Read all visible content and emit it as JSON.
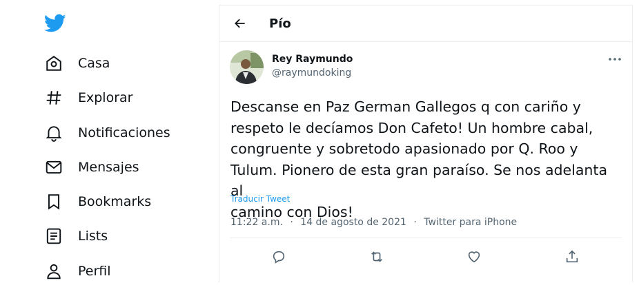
{
  "colors": {
    "brand": "#1d9bf0",
    "text": "#0f1419",
    "muted": "#536471",
    "border": "#ebeef0"
  },
  "sidebar": {
    "logo_icon": "twitter-bird-icon",
    "items": [
      {
        "label": "Casa",
        "icon": "home-icon"
      },
      {
        "label": "Explorar",
        "icon": "hashtag-icon"
      },
      {
        "label": "Notificaciones",
        "icon": "bell-icon"
      },
      {
        "label": "Mensajes",
        "icon": "mail-icon"
      },
      {
        "label": "Bookmarks",
        "icon": "bookmark-icon"
      },
      {
        "label": "Lists",
        "icon": "list-icon"
      },
      {
        "label": "Perfil",
        "icon": "person-icon"
      }
    ]
  },
  "header": {
    "title": "Pío",
    "back_icon": "back-arrow-icon"
  },
  "tweet": {
    "author_name": "Rey Raymundo",
    "author_handle": "@raymundoking",
    "lines": [
      "Descanse en Paz German Gallegos q con cariño y",
      "respeto le decíamos Don Cafeto! Un hombre cabal,",
      "congruente y sobretodo apasionado por Q. Roo y",
      "Tulum. Pionero de esta gran paraíso. Se nos adelanta al",
      "camino con Dios!"
    ],
    "translate_label": "Traducir Tweet",
    "time": "11:22 a.m.",
    "sep": "·",
    "date": "14 de agosto de 2021",
    "source": "Twitter para iPhone"
  },
  "actions": [
    "reply-icon",
    "retweet-icon",
    "like-icon",
    "share-icon"
  ]
}
